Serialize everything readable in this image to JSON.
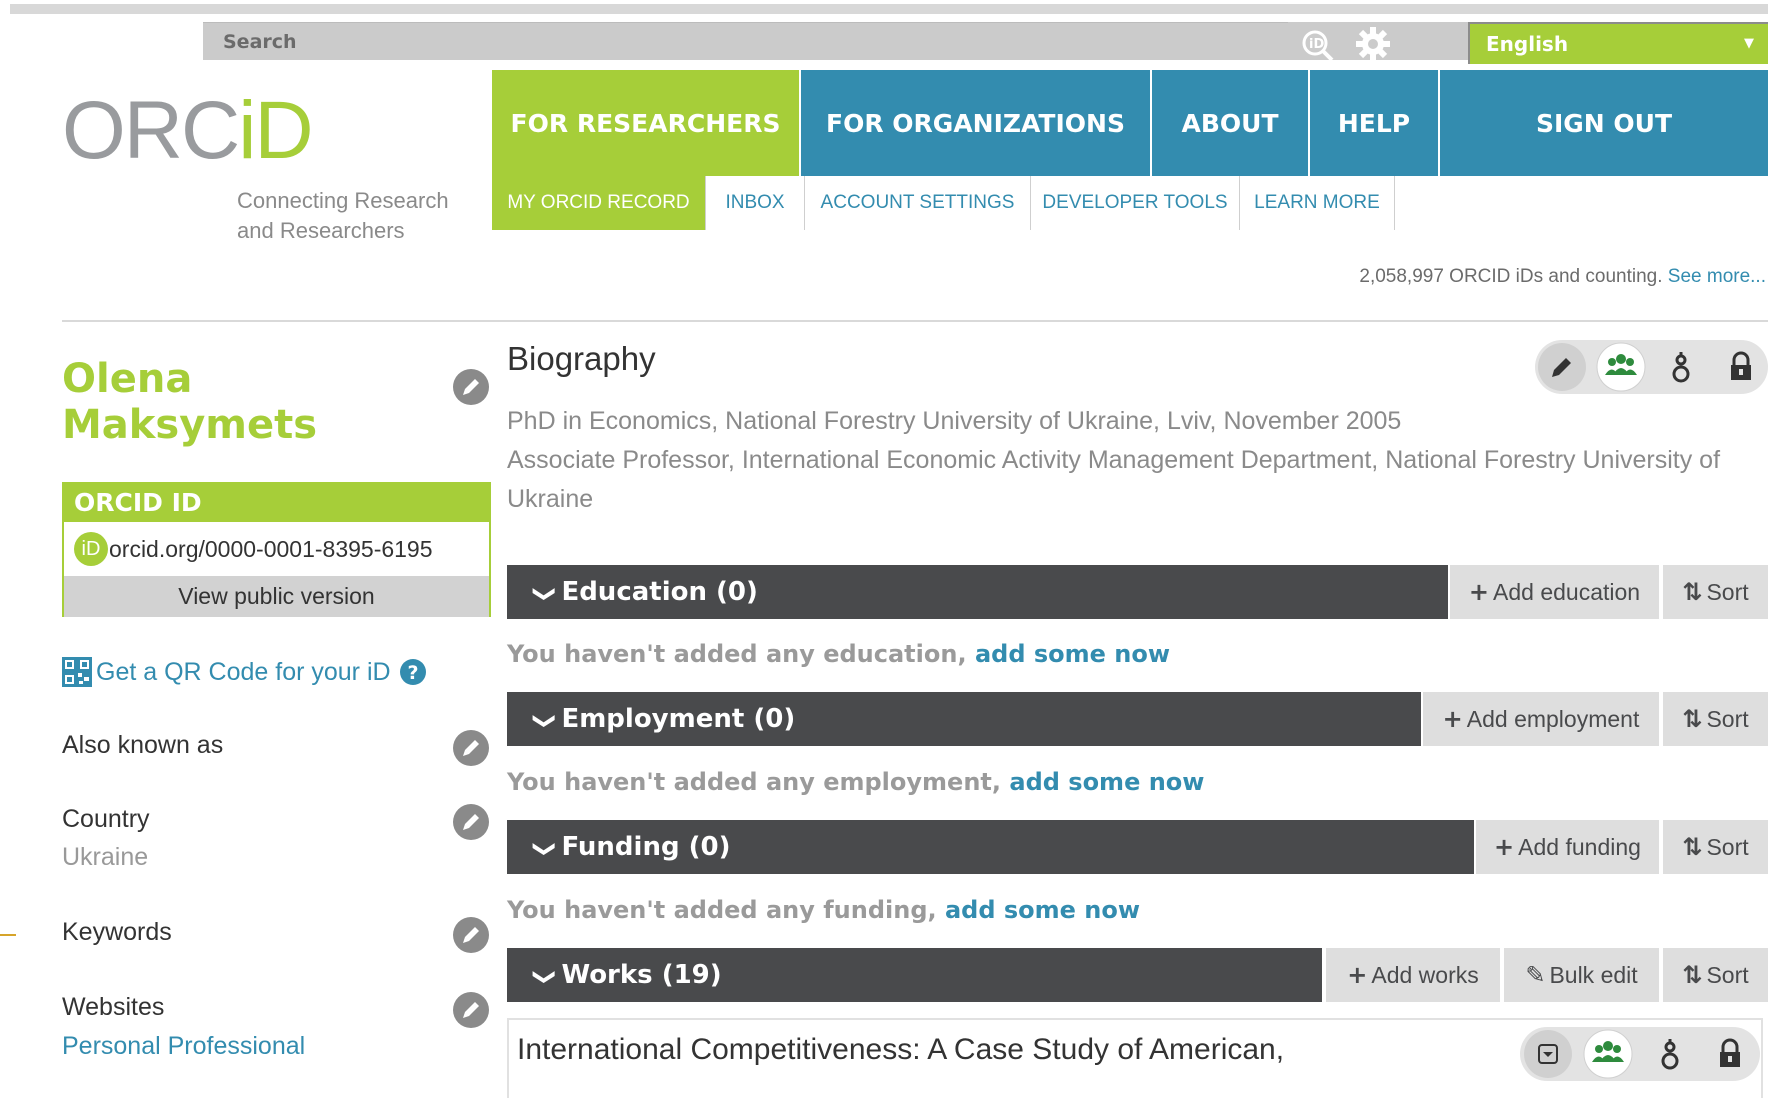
{
  "search": {
    "placeholder": "Search"
  },
  "language": {
    "selected": "English"
  },
  "logo": {
    "text_orc": "ORC",
    "text_id": "iD",
    "tagline_line1": "Connecting Research",
    "tagline_line2": "and Researchers"
  },
  "nav": {
    "tabs": [
      {
        "label": "FOR RESEARCHERS",
        "active": true
      },
      {
        "label": "FOR ORGANIZATIONS",
        "active": false
      },
      {
        "label": "ABOUT",
        "active": false
      },
      {
        "label": "HELP",
        "active": false
      },
      {
        "label": "SIGN OUT",
        "active": false
      }
    ],
    "subtabs": [
      {
        "label": "MY ORCID RECORD",
        "active": true
      },
      {
        "label": "INBOX",
        "active": false
      },
      {
        "label": "ACCOUNT SETTINGS",
        "active": false
      },
      {
        "label": "DEVELOPER TOOLS",
        "active": false
      },
      {
        "label": "LEARN MORE",
        "active": false
      }
    ]
  },
  "counter": {
    "text": "2,058,997 ORCID iDs and counting.",
    "link": "See more..."
  },
  "profile": {
    "first_name": "Olena",
    "last_name": "Maksymets",
    "orcid_header": "ORCID ID",
    "orcid_badge": "iD",
    "orcid_url": "orcid.org/0000-0001-8395-6195",
    "view_public": "View public version",
    "qr_text": "Get a QR Code for your iD",
    "also_known_as": "Also known as",
    "country_label": "Country",
    "country_value": "Ukraine",
    "keywords_label": "Keywords",
    "websites_label": "Websites",
    "website_link": "Personal Professional"
  },
  "biography": {
    "title": "Biography",
    "line1": "PhD in Economics, National Forestry University of Ukraine, Lviv, November 2005",
    "line2": "Associate Professor, International Economic Activity Management Department, National Forestry University of Ukraine"
  },
  "sections": {
    "education": {
      "title": "Education (0)",
      "add": "Add education",
      "sort": "Sort",
      "empty": "You haven't added any education,",
      "empty_link": "add some now"
    },
    "employment": {
      "title": "Employment (0)",
      "add": "Add employment",
      "sort": "Sort",
      "empty": "You haven't added any employment,",
      "empty_link": "add some now"
    },
    "funding": {
      "title": "Funding (0)",
      "add": "Add funding",
      "sort": "Sort",
      "empty": "You haven't added any funding,",
      "empty_link": "add some now"
    },
    "works": {
      "title": "Works (19)",
      "add": "Add works",
      "bulk": "Bulk edit",
      "sort": "Sort"
    }
  },
  "work_item": {
    "title": "International Competitiveness: A Case Study of American,"
  },
  "colors": {
    "green": "#a6ce39",
    "blue": "#338caf",
    "dark": "#494a4c"
  }
}
